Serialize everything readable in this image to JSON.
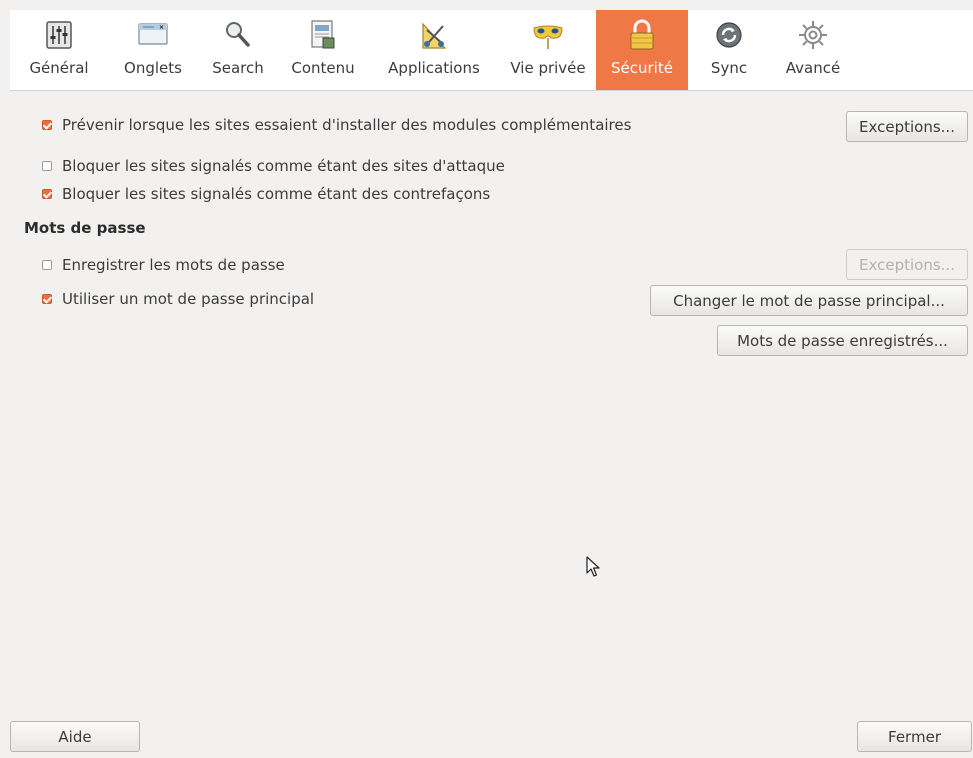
{
  "tabs": [
    {
      "label": "Général",
      "icon": "general-sliders-icon"
    },
    {
      "label": "Onglets",
      "icon": "tabs-window-icon"
    },
    {
      "label": "Search",
      "icon": "search-magnifier-icon"
    },
    {
      "label": "Contenu",
      "icon": "content-page-icon"
    },
    {
      "label": "Applications",
      "icon": "applications-tools-icon"
    },
    {
      "label": "Vie privée",
      "icon": "privacy-mask-icon"
    },
    {
      "label": "Sécurité",
      "icon": "security-padlock-icon",
      "active": true
    },
    {
      "label": "Sync",
      "icon": "sync-arrows-icon"
    },
    {
      "label": "Avancé",
      "icon": "advanced-gear-icon"
    }
  ],
  "accent_color": "#f07746",
  "security": {
    "warn_addons": {
      "label": "Prévenir lorsque les sites essaient d'installer des modules complémentaires",
      "checked": true
    },
    "block_attack": {
      "label": "Bloquer les sites signalés comme étant des sites d'attaque",
      "checked": false
    },
    "block_forgery": {
      "label": "Bloquer les sites signalés comme étant des contrefaçons",
      "checked": true
    },
    "exceptions_label": "Exceptions..."
  },
  "passwords": {
    "section_title": "Mots de passe",
    "remember": {
      "label": "Enregistrer les mots de passe",
      "checked": false
    },
    "master": {
      "label": "Utiliser un mot de passe principal",
      "checked": true
    },
    "exceptions_label": "Exceptions...",
    "change_master_label": "Changer le mot de passe principal...",
    "saved_passwords_label": "Mots de passe enregistrés..."
  },
  "footer": {
    "help_label": "Aide",
    "close_label": "Fermer"
  }
}
